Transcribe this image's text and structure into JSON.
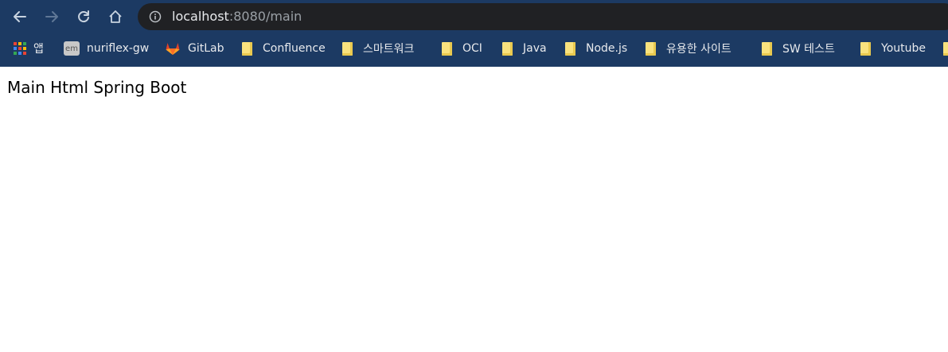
{
  "browser": {
    "url_host": "localhost",
    "url_rest": ":8080/main",
    "colors": {
      "frame": "#1c3a63",
      "omnibox": "#202124",
      "icon": "#c8d3e0"
    }
  },
  "bookmarks": [
    {
      "label": "앱",
      "icon": "apps-grid-icon"
    },
    {
      "label": "nuriflex-gw",
      "icon": "em-favicon-icon",
      "icon_text": "em"
    },
    {
      "label": "GitLab",
      "icon": "gitlab-icon"
    },
    {
      "label": "Confluence",
      "icon": "folder-icon"
    },
    {
      "label": "스마트워크",
      "icon": "folder-icon"
    },
    {
      "label": "OCI",
      "icon": "folder-icon"
    },
    {
      "label": "Java",
      "icon": "folder-icon"
    },
    {
      "label": "Node.js",
      "icon": "folder-icon"
    },
    {
      "label": "유용한 사이트",
      "icon": "folder-icon"
    },
    {
      "label": "SW 테스트",
      "icon": "folder-icon"
    },
    {
      "label": "Youtube",
      "icon": "folder-icon"
    }
  ],
  "page": {
    "main_text": "Main Html Spring Boot"
  }
}
